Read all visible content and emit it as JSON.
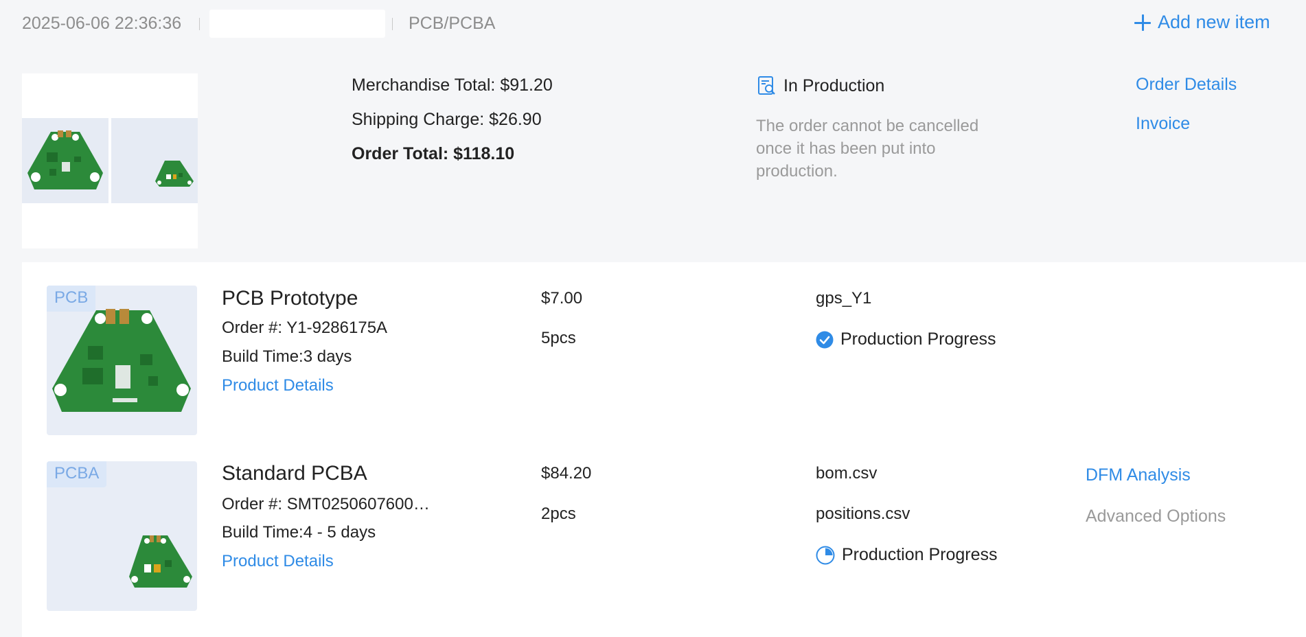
{
  "header": {
    "datetime": "2025-06-06 22:36:36",
    "input_value": "",
    "category": "PCB/PCBA",
    "add_label": "Add new item"
  },
  "summary": {
    "merchandise": "Merchandise Total: $91.20",
    "shipping": "Shipping Charge: $26.90",
    "total": "Order Total: $118.10",
    "status": "In Production",
    "status_note": "The order cannot be cancelled once it has been put into production.",
    "order_details": "Order Details",
    "invoice": "Invoice"
  },
  "items": [
    {
      "tag": "PCB",
      "title": "PCB Prototype",
      "order_no": "Order #: Y1-9286175A",
      "build_time": "Build Time:3 days",
      "details_link": "Product Details",
      "price": "$7.00",
      "qty": "5pcs",
      "file": "gps_Y1",
      "progress": "Production Progress",
      "progress_icon": "check-circle-icon"
    },
    {
      "tag": "PCBA",
      "title": "Standard PCBA",
      "order_no": "Order #: SMT0250607600…",
      "build_time": "Build Time:4 - 5 days",
      "details_link": "Product Details",
      "price": "$84.20",
      "qty": "2pcs",
      "file1": "bom.csv",
      "file2": "positions.csv",
      "progress": "Production Progress",
      "progress_icon": "pie-progress-icon",
      "dfm": "DFM Analysis",
      "advanced": "Advanced Options"
    }
  ],
  "colors": {
    "accent": "#2f8be6",
    "pcb_green": "#2c8a3a",
    "background": "#f5f6f8",
    "muted_text": "#9a9a9a"
  }
}
